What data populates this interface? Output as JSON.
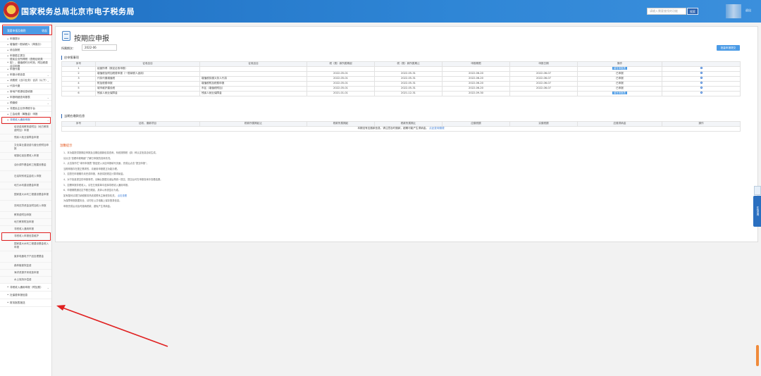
{
  "header": {
    "title": "国家税务总局北京市电子税务局",
    "search_placeholder": "请输入需要查找的功能",
    "search_button": "搜索",
    "logout": "退出"
  },
  "sidebar": {
    "head_label": "我要申报及缴税",
    "head_action": "收起",
    "items": [
      {
        "label": "申报提示",
        "chevron": false
      },
      {
        "label": "增值税一般纳税人（简易办）",
        "chevron": false
      },
      {
        "label": "综合报税",
        "chevron": false
      },
      {
        "label": "申报更正提交",
        "chevron": false
      },
      {
        "label": "居民企业所得税（查账征收类型）、增值税时分时效、附加税费合并申报",
        "chevron": false
      },
      {
        "label": "申报作废",
        "chevron": false
      },
      {
        "label": "申报计税信息",
        "chevron": true
      },
      {
        "label": "消费税（出口业务）合并（以下）",
        "chevron": true
      },
      {
        "label": "代扣代缴",
        "chevron": false
      },
      {
        "label": "房地产税源信息填报",
        "chevron": false
      },
      {
        "label": "申报明细查询报表",
        "chevron": true
      },
      {
        "label": "预缴税",
        "chevron": true
      },
      {
        "label": "非居民企业所得税平台",
        "chevron": false
      },
      {
        "label": "工会经费（筹备金）申报",
        "chevron": false
      },
      {
        "label": "非税收入通用申报",
        "chevron": true
      }
    ],
    "sub_items": [
      "培训费用教育费附加（地方教育费附加）申报",
      "残疾人就业保障金申报",
      "文化事业建设费与营业税附加申报",
      "城镇垃圾处理收入申报",
      "油价调节基金和工程建设基金",
      "石油特别收益金收入申报",
      "地方水利建设基金申报",
      "国家重大水利工程建设基金申报",
      "农网还贷资金及附加收入申报",
      "教育费附加申报",
      "地方教育附加申报",
      "非税收入通用申报",
      "非税收入申报信息维护",
      "国家重大水利工程建设基金收入申报",
      "废弃电器电子产品处理基金",
      "森林植被恢复费",
      "海洋资源开采收费申报",
      "水土保持补偿费"
    ],
    "bottom_items": [
      {
        "label": "非税收入通用申报（附加费）",
        "chevron": true
      },
      {
        "label": "社保费申报信息",
        "chevron": false
      },
      {
        "label": "财务报表报送",
        "chevron": false
      }
    ]
  },
  "page": {
    "title": "按期应申报",
    "period_label": "所属期次：",
    "period_value": "2022-06",
    "section1": "应申报事项",
    "section2": "当期应缴款信息",
    "batch_button": "批量申报提交"
  },
  "table1": {
    "headers": [
      "序号",
      "征收品目",
      "征收品目",
      "税（费）款所属期起",
      "税（费）款所属期止",
      "申报期限",
      "申报日期",
      "操作",
      ""
    ],
    "rows": [
      {
        "no": "1",
        "item": "经营所得（核定征收申报）",
        "sub": "",
        "start": "",
        "end": "",
        "deadline": "",
        "date": "",
        "op": "填写申报表",
        "btn": true
      },
      {
        "no": "2",
        "item": "增值税及附加税费申报（一般纳税人适用）",
        "sub": "",
        "start": "2022-05-01",
        "end": "2022-05-31",
        "deadline": "2022-06-20",
        "date": "2022-06-07",
        "op": "已申报",
        "btn": false
      },
      {
        "no": "3",
        "item": "代扣代缴增值税",
        "sub": "增值税扣缴义务人代扣",
        "start": "2022-05-01",
        "end": "2022-05-31",
        "deadline": "2022-06-20",
        "date": "2022-06-07",
        "op": "已申报",
        "btn": false
      },
      {
        "no": "4",
        "item": "附加税费申报",
        "sub": "增值税附加税费申报",
        "start": "2022-05-01",
        "end": "2022-05-31",
        "deadline": "2022-06-20",
        "date": "2022-06-07",
        "op": "已申报",
        "btn": false
      },
      {
        "no": "5",
        "item": "城市维护建设税",
        "sub": "市区（增值税附加）",
        "start": "2022-05-01",
        "end": "2022-05-31",
        "deadline": "2022-06-20",
        "date": "2022-06-07",
        "op": "已申报",
        "btn": false
      },
      {
        "no": "6",
        "item": "残疾人就业保障金",
        "sub": "残疾人就业保障金",
        "start": "2021-01-01",
        "end": "2021-12-31",
        "deadline": "2022-09-30",
        "date": "",
        "op": "填写申报表",
        "btn": true
      }
    ]
  },
  "table2": {
    "headers": [
      "序号",
      "征收、缴款项目",
      "税款所属期起止",
      "税款所属期起",
      "税款所属期止",
      "应缴税额",
      "实缴税额",
      "应缴滞纳金",
      "操作"
    ],
    "empty_text": "本期没有应缴款信息，请注意及时缴款，超期可能产生滞纳金。",
    "empty_link": "点此查询缴费"
  },
  "tips": {
    "title": "温馨提示",
    "lines": [
      "1、本功能提供按期应申报及当期应缴款信息查询，系统按照税（费）种认定信息自动生成。",
      "请点击“查看申报明细”了解已申报的具体情况。",
      "2、点击操作栏“填写申报表”按钮进入对应申报填写页面，完成后点击“提交申报”。",
      "当期申报存在更正需求的，请使用申报更正功能办理。",
      "3、如您在申报期内未完成申报，系统将按规定计算滞纳金。",
      "4、对于批量提交的申报事项，请确认数据无误后再统一提交，提交后可在申报查询中查看结果。",
      "5、如需申报非税收入，请在左侧菜单中选择非税收入通用申报。",
      "6、申报期限遇法定节假日顺延，具体以系统显示为准。",
      "如有疑问请拨打纳税服务热线或联系主管税务机关。",
      "为保障申报数据安全，请勿在公共电脑上保存登录信息。",
      "申报完成后请及时缴纳税款，避免产生滞纳金。"
    ],
    "link": "点击查看"
  },
  "right_tab": "在线咨询",
  "colors": {
    "header": "#2f86d6",
    "accent": "#4b9be6",
    "highlight": "#e02020",
    "tip_title": "#e4602a"
  }
}
